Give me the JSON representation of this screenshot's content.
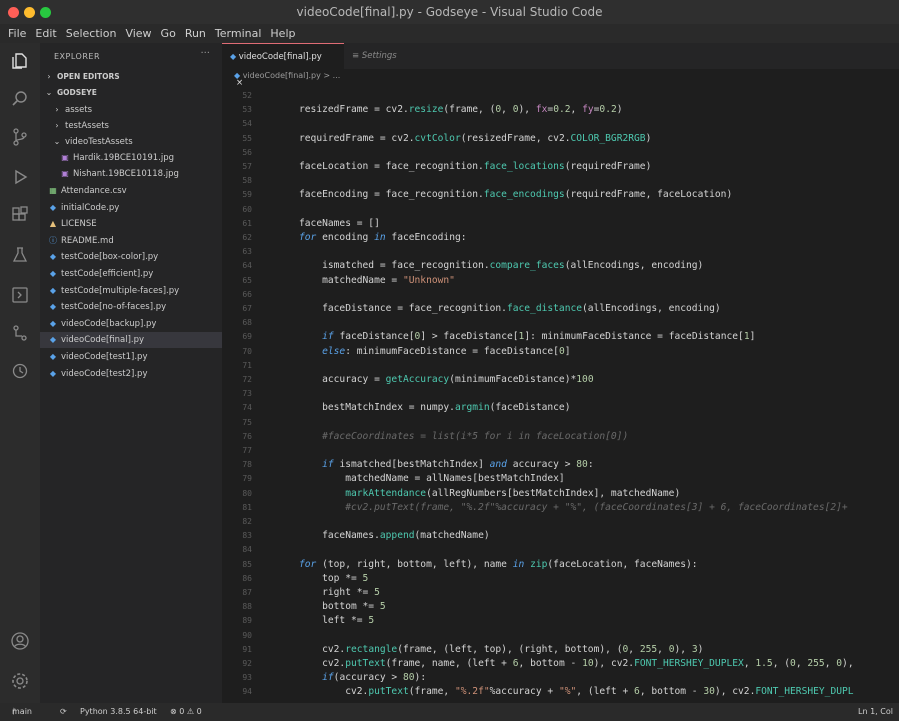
{
  "window": {
    "title": "videoCode[final].py - Godseye - Visual Studio Code"
  },
  "menu": [
    "File",
    "Edit",
    "Selection",
    "View",
    "Go",
    "Run",
    "Terminal",
    "Help"
  ],
  "sidebar": {
    "header": "EXPLORER",
    "more": "···",
    "sections": {
      "open_editors": "OPEN EDITORS",
      "project": "GODSEYE"
    },
    "items": [
      {
        "label": "assets"
      },
      {
        "label": "testAssets"
      },
      {
        "label": "videoTestAssets"
      },
      {
        "label": "Hardik.19BCE10191.jpg"
      },
      {
        "label": "Nishant.19BCE10118.jpg"
      },
      {
        "label": "Attendance.csv"
      },
      {
        "label": "initialCode.py"
      },
      {
        "label": "LICENSE"
      },
      {
        "label": "README.md"
      },
      {
        "label": "testCode[box-color].py"
      },
      {
        "label": "testCode[efficient].py"
      },
      {
        "label": "testCode[multiple-faces].py"
      },
      {
        "label": "testCode[no-of-faces].py"
      },
      {
        "label": "videoCode[backup].py"
      },
      {
        "label": "videoCode[final].py"
      },
      {
        "label": "videoCode[test1].py"
      },
      {
        "label": "videoCode[test2].py"
      }
    ]
  },
  "tabs": [
    {
      "label": "videoCode[final].py",
      "close": "×"
    },
    {
      "label": "Settings"
    }
  ],
  "breadcrumb": "videoCode[final].py > ...",
  "code": {
    "lines": [
      {
        "n": "52",
        "t": ""
      },
      {
        "n": "53",
        "t": "resizedFrame = cv2.resize(frame, (0, 0), fx=0.2, fy=0.2)"
      },
      {
        "n": "54",
        "t": ""
      },
      {
        "n": "55",
        "t": "requiredFrame = cv2.cvtColor(resizedFrame, cv2.COLOR_BGR2RGB)"
      },
      {
        "n": "56",
        "t": ""
      },
      {
        "n": "57",
        "t": "faceLocation = face_recognition.face_locations(requiredFrame)"
      },
      {
        "n": "58",
        "t": ""
      },
      {
        "n": "59",
        "t": "faceEncoding = face_recognition.face_encodings(requiredFrame, faceLocation)"
      },
      {
        "n": "60",
        "t": ""
      },
      {
        "n": "61",
        "t": "faceNames = []"
      },
      {
        "n": "62",
        "t": "for encoding in faceEncoding:"
      },
      {
        "n": "63",
        "t": ""
      },
      {
        "n": "64",
        "t": "    ismatched = face_recognition.compare_faces(allEncodings, encoding)"
      },
      {
        "n": "65",
        "t": "    matchedName = \"Unknown\""
      },
      {
        "n": "66",
        "t": ""
      },
      {
        "n": "67",
        "t": "    faceDistance = face_recognition.face_distance(allEncodings, encoding)"
      },
      {
        "n": "68",
        "t": ""
      },
      {
        "n": "69",
        "t": "    if faceDistance[0] > faceDistance[1]: minimumFaceDistance = faceDistance[1]"
      },
      {
        "n": "70",
        "t": "    else: minimumFaceDistance = faceDistance[0]"
      },
      {
        "n": "71",
        "t": ""
      },
      {
        "n": "72",
        "t": "    accuracy = getAccuracy(minimumFaceDistance)*100"
      },
      {
        "n": "73",
        "t": ""
      },
      {
        "n": "74",
        "t": "    bestMatchIndex = numpy.argmin(faceDistance)"
      },
      {
        "n": "75",
        "t": ""
      },
      {
        "n": "76",
        "t": "    #faceCoordinates = list(i*5 for i in faceLocation[0])"
      },
      {
        "n": "77",
        "t": ""
      },
      {
        "n": "78",
        "t": "    if ismatched[bestMatchIndex] and accuracy > 80:"
      },
      {
        "n": "79",
        "t": "        matchedName = allNames[bestMatchIndex]"
      },
      {
        "n": "80",
        "t": "        markAttendance(allRegNumbers[bestMatchIndex], matchedName)"
      },
      {
        "n": "81",
        "t": "        #cv2.putText(frame, \"%.2f\"%accuracy + \"%\", (faceCoordinates[3] + 6, faceCoordinates[2]+"
      },
      {
        "n": "82",
        "t": ""
      },
      {
        "n": "83",
        "t": "    faceNames.append(matchedName)"
      },
      {
        "n": "84",
        "t": ""
      },
      {
        "n": "85",
        "t": "for (top, right, bottom, left), name in zip(faceLocation, faceNames):"
      },
      {
        "n": "86",
        "t": "    top *= 5"
      },
      {
        "n": "87",
        "t": "    right *= 5"
      },
      {
        "n": "88",
        "t": "    bottom *= 5"
      },
      {
        "n": "89",
        "t": "    left *= 5"
      },
      {
        "n": "90",
        "t": ""
      },
      {
        "n": "91",
        "t": "    cv2.rectangle(frame, (left, top), (right, bottom), (0, 255, 0), 3)"
      },
      {
        "n": "92",
        "t": "    cv2.putText(frame, name, (left + 6, bottom - 10), cv2.FONT_HERSHEY_DUPLEX, 1.5, (0, 255, 0),"
      },
      {
        "n": "93",
        "t": "    if(accuracy > 80):"
      },
      {
        "n": "94",
        "t": "        cv2.putText(frame, \"%.2f\"%accuracy + \"%\", (left + 6, bottom - 30), cv2.FONT_HERSHEY_DUPL"
      }
    ]
  },
  "status": {
    "branch": "main",
    "python": "Python 3.8.5 64-bit",
    "problems": "⊗ 0 ⚠ 0",
    "position": "Ln 1, Col"
  },
  "colors": {
    "close_dot": "#ff5f57",
    "min_dot": "#febc2e",
    "max_dot": "#28c840"
  }
}
